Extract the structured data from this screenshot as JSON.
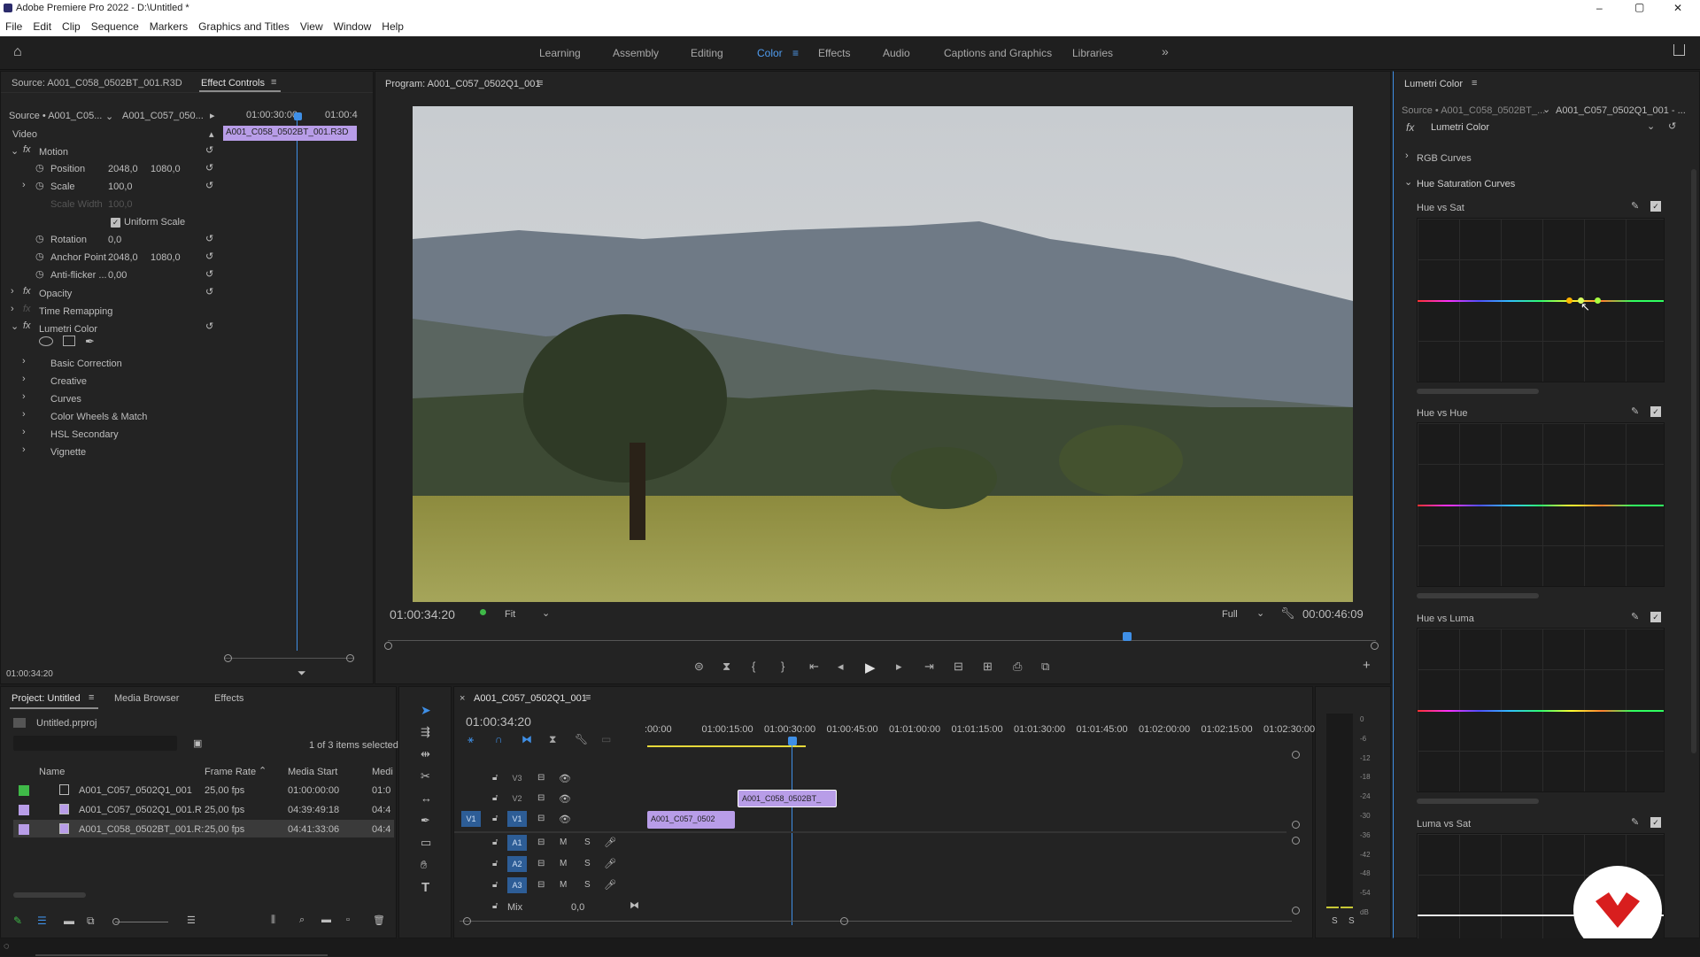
{
  "window": {
    "title": "Adobe Premiere Pro 2022 - D:\\Untitled *",
    "min": "–",
    "max": "▢",
    "close": "✕"
  },
  "menu": [
    "File",
    "Edit",
    "Clip",
    "Sequence",
    "Markers",
    "Graphics and Titles",
    "View",
    "Window",
    "Help"
  ],
  "workspaces": [
    "Learning",
    "Assembly",
    "Editing",
    "Color",
    "Effects",
    "Audio",
    "Captions and Graphics",
    "Libraries"
  ],
  "workspace_more": "»",
  "effect_controls": {
    "tab_source": "Source: A001_C058_0502BT_001.R3D",
    "tab_active": "Effect Controls",
    "source_label": "Source • A001_C05...",
    "seq_label": "A001_C057_050...",
    "time1": "01:00:30:00",
    "time2": "01:00:4",
    "clip_label": "A001_C058_0502BT_001.R3D",
    "section": "Video",
    "motion": "Motion",
    "position": "Position",
    "pos_x": "2048,0",
    "pos_y": "1080,0",
    "scale": "Scale",
    "scale_v": "100,0",
    "scale_width": "Scale Width",
    "scale_width_v": "100,0",
    "uniform": "Uniform Scale",
    "rotation": "Rotation",
    "rotation_v": "0,0",
    "anchor": "Anchor Point",
    "anc_x": "2048,0",
    "anc_y": "1080,0",
    "antiflicker": "Anti-flicker ...",
    "antiflicker_v": "0,00",
    "opacity": "Opacity",
    "time_remap": "Time Remapping",
    "lumetri": "Lumetri Color",
    "subs": [
      "Basic Correction",
      "Creative",
      "Curves",
      "Color Wheels & Match",
      "HSL Secondary",
      "Vignette"
    ],
    "timecode": "01:00:34:20"
  },
  "program": {
    "title": "Program: A001_C057_0502Q1_001",
    "timecode": "01:00:34:20",
    "fit": "Fit",
    "quality": "Full",
    "duration": "00:00:46:09"
  },
  "lumetri": {
    "title": "Lumetri Color",
    "source": "Source • A001_C058_0502BT_...",
    "seq": "A001_C057_0502Q1_001 - ...",
    "effect": "Lumetri Color",
    "rgb_curves": "RGB Curves",
    "hue_sat_curves": "Hue Saturation Curves",
    "curves": [
      "Hue vs Sat",
      "Hue vs Hue",
      "Hue vs Luma",
      "Luma vs Sat"
    ]
  },
  "project": {
    "tabs": [
      "Project: Untitled",
      "Media Browser",
      "Effects"
    ],
    "file": "Untitled.prproj",
    "selected": "1 of 3 items selected",
    "cols": [
      "Name",
      "Frame Rate",
      "Media Start",
      "Medi"
    ],
    "rows": [
      {
        "name": "A001_C057_0502Q1_001",
        "fps": "25,00 fps",
        "start": "01:00:00:00",
        "end": "01:0",
        "color": "#3fb948"
      },
      {
        "name": "A001_C057_0502Q1_001.R",
        "fps": "25,00 fps",
        "start": "04:39:49:18",
        "end": "04:4",
        "color": "#b89de8"
      },
      {
        "name": "A001_C058_0502BT_001.R:",
        "fps": "25,00 fps",
        "start": "04:41:33:06",
        "end": "04:4",
        "color": "#b89de8"
      }
    ]
  },
  "timeline": {
    "title": "A001_C057_0502Q1_001",
    "timecode": "01:00:34:20",
    "ruler": [
      ":00:00",
      "01:00:15:00",
      "01:00:30:00",
      "01:00:45:00",
      "01:01:00:00",
      "01:01:15:00",
      "01:01:30:00",
      "01:01:45:00",
      "01:02:00:00",
      "01:02:15:00",
      "01:02:30:00"
    ],
    "tracks": [
      "V3",
      "V2",
      "V1",
      "A1",
      "A2",
      "A3"
    ],
    "v1_src": "V1",
    "mix": "Mix",
    "mix_v": "0,0",
    "clip_v1": "A001_C057_0502",
    "clip_v2": "A001_C058_0502BT_",
    "meter": [
      "0",
      "-6",
      "-12",
      "-18",
      "-24",
      "-30",
      "-36",
      "-42",
      "-48",
      "-54",
      "dB"
    ],
    "solo": "S"
  }
}
